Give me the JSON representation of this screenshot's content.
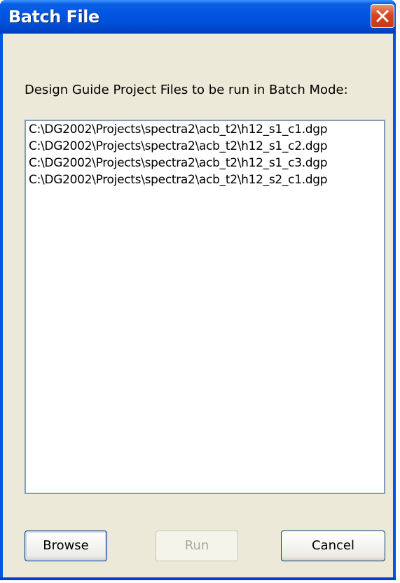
{
  "window": {
    "title": "Batch File"
  },
  "instructions": "Design Guide Project Files to be run in Batch Mode:",
  "files": [
    "C:\\DG2002\\Projects\\spectra2\\acb_t2\\h12_s1_c1.dgp",
    "C:\\DG2002\\Projects\\spectra2\\acb_t2\\h12_s1_c2.dgp",
    "C:\\DG2002\\Projects\\spectra2\\acb_t2\\h12_s1_c3.dgp",
    "C:\\DG2002\\Projects\\spectra2\\acb_t2\\h12_s2_c1.dgp"
  ],
  "buttons": {
    "browse": "Browse",
    "run": "Run",
    "cancel": "Cancel"
  },
  "colors": {
    "titlebar": "#0054e3",
    "close": "#d9451e",
    "dialog_bg": "#ece9d8",
    "list_border": "#7f9db9"
  }
}
